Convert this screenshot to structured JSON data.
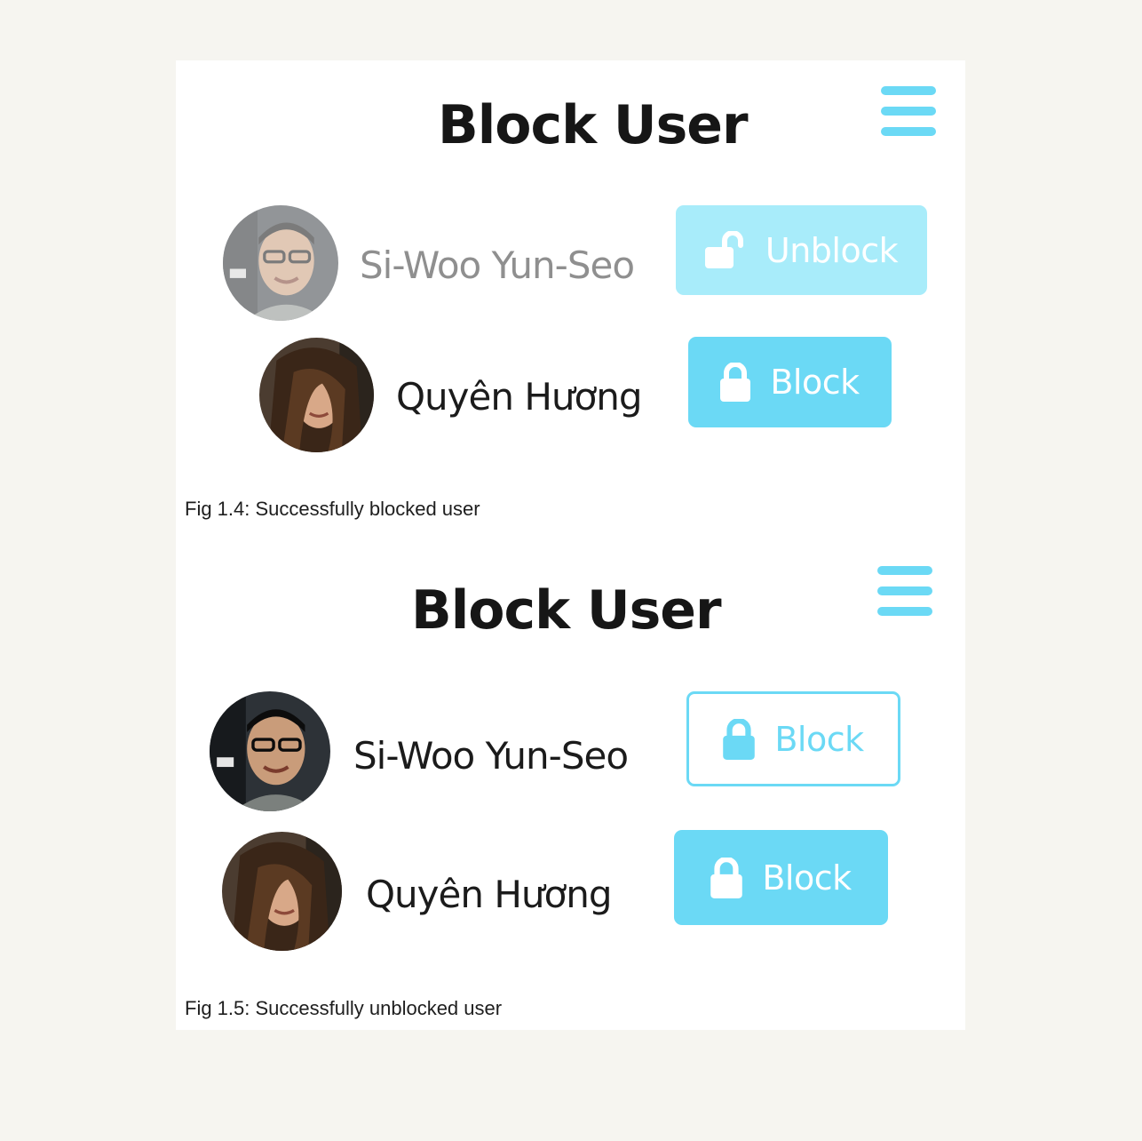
{
  "colors": {
    "accent": "#6bd9f5",
    "accent_pale": "#a8ecfa",
    "page_bg": "#f6f5f0"
  },
  "figure_a": {
    "title": "Block User",
    "menu_icon": "hamburger-menu-icon",
    "users": [
      {
        "name": "Si-Woo Yun-Seo",
        "button_label": "Unblock",
        "button_icon": "unlock-icon",
        "state": "blocked"
      },
      {
        "name": "Quyên Hương",
        "button_label": "Block",
        "button_icon": "lock-icon",
        "state": "normal"
      }
    ],
    "caption": "Fig 1.4: Successfully blocked user"
  },
  "figure_b": {
    "title": "Block User",
    "menu_icon": "hamburger-menu-icon",
    "users": [
      {
        "name": "Si-Woo Yun-Seo",
        "button_label": "Block",
        "button_icon": "lock-icon",
        "state": "unblocked"
      },
      {
        "name": "Quyên Hương",
        "button_label": "Block",
        "button_icon": "lock-icon",
        "state": "normal"
      }
    ],
    "caption": "Fig 1.5: Successfully unblocked user"
  }
}
